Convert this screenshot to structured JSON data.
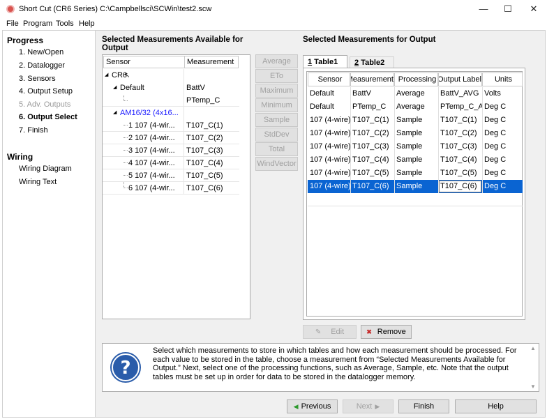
{
  "window": {
    "title": "Short Cut (CR6 Series) C:\\Campbellsci\\SCWin\\test2.scw"
  },
  "menu": [
    "File",
    "Program",
    "Tools",
    "Help"
  ],
  "sidebar": {
    "progress_heading": "Progress",
    "items": [
      "1. New/Open",
      "2. Datalogger",
      "3. Sensors",
      "4. Output Setup",
      "5. Adv. Outputs",
      "6. Output Select",
      "7. Finish"
    ],
    "wiring_heading": "Wiring",
    "wiring_items": [
      "Wiring Diagram",
      "Wiring Text"
    ]
  },
  "left_panel": {
    "title": "Selected Measurements Available for Output",
    "headers": [
      "Sensor",
      "Measurement"
    ],
    "tree": [
      {
        "sensor": "CR6",
        "measurement": ""
      },
      {
        "sensor": "Default",
        "measurement": "BattV"
      },
      {
        "sensor": "",
        "measurement": "PTemp_C"
      },
      {
        "sensor": "AM16/32 (4x16...",
        "measurement": ""
      },
      {
        "sensor": "1 107 (4-wir...",
        "measurement": "T107_C(1)"
      },
      {
        "sensor": "2 107 (4-wir...",
        "measurement": "T107_C(2)"
      },
      {
        "sensor": "3 107 (4-wir...",
        "measurement": "T107_C(3)"
      },
      {
        "sensor": "4 107 (4-wir...",
        "measurement": "T107_C(4)"
      },
      {
        "sensor": "5 107 (4-wir...",
        "measurement": "T107_C(5)"
      },
      {
        "sensor": "6 107 (4-wir...",
        "measurement": "T107_C(6)"
      }
    ]
  },
  "functions": [
    "Average",
    "ETo",
    "Maximum",
    "Minimum",
    "Sample",
    "StdDev",
    "Total",
    "WindVector"
  ],
  "right_panel": {
    "title": "Selected Measurements for Output",
    "tabs": [
      {
        "num": "1",
        "label": " Table1"
      },
      {
        "num": "2",
        "label": " Table2"
      }
    ],
    "headers": [
      "Sensor",
      "Measurement",
      "Processing",
      "Output Label",
      "Units"
    ],
    "rows": [
      [
        "Default",
        "BattV",
        "Average",
        "BattV_AVG",
        "Volts"
      ],
      [
        "Default",
        "PTemp_C",
        "Average",
        "PTemp_C_AVG",
        "Deg C"
      ],
      [
        "107 (4-wire)",
        "T107_C(1)",
        "Sample",
        "T107_C(1)",
        "Deg C"
      ],
      [
        "107 (4-wire)",
        "T107_C(2)",
        "Sample",
        "T107_C(2)",
        "Deg C"
      ],
      [
        "107 (4-wire)",
        "T107_C(3)",
        "Sample",
        "T107_C(3)",
        "Deg C"
      ],
      [
        "107 (4-wire)",
        "T107_C(4)",
        "Sample",
        "T107_C(4)",
        "Deg C"
      ],
      [
        "107 (4-wire)",
        "T107_C(5)",
        "Sample",
        "T107_C(5)",
        "Deg C"
      ],
      [
        "107 (4-wire)",
        "T107_C(6)",
        "Sample",
        "T107_C(6)",
        "Deg C"
      ]
    ],
    "selected_row": 7,
    "edit_label": "Edit",
    "remove_label": "Remove"
  },
  "help": {
    "text": "Select which measurements to store in which tables and how each measurement should be processed. For each value to be stored in the table, choose a measurement from “Selected Measurements Available for Output.”  Next, select one of the processing functions, such as Average, Sample, etc. Note that the output tables must be set up in order for data to be stored in the datalogger memory."
  },
  "footer": {
    "previous": "Previous",
    "next": "Next",
    "finish": "Finish",
    "help": "Help"
  },
  "colors": {
    "selection": "#0a64d2",
    "tree_blue": "#1a1aff",
    "help_icon": "#2a5caa"
  }
}
